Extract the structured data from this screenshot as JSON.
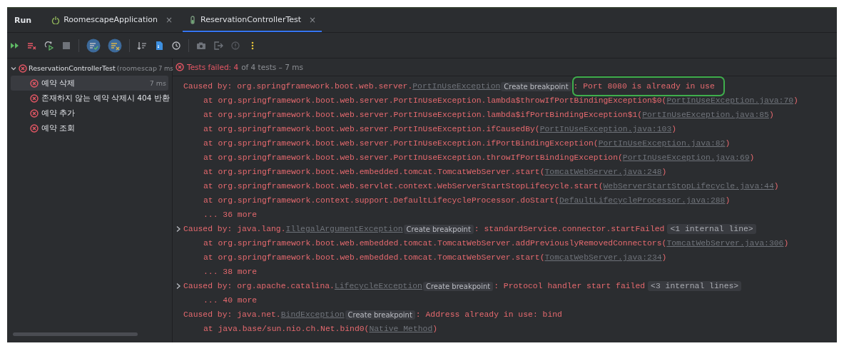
{
  "panel": {
    "title": "Run"
  },
  "tabs": [
    {
      "label": "RoomescapeApplication",
      "close": "×",
      "selected": false
    },
    {
      "label": "ReservationControllerTest",
      "close": "×",
      "selected": true
    }
  ],
  "toolbar": [
    {
      "kind": "rerun"
    },
    {
      "kind": "rerun-failed"
    },
    {
      "kind": "toggle-auto"
    },
    {
      "kind": "stop"
    },
    {
      "kind": "sep"
    },
    {
      "kind": "show-passed",
      "selected": true
    },
    {
      "kind": "show-ignored",
      "selected": true
    },
    {
      "kind": "sep"
    },
    {
      "kind": "sort"
    },
    {
      "kind": "import"
    },
    {
      "kind": "history"
    },
    {
      "kind": "sep"
    },
    {
      "kind": "camera"
    },
    {
      "kind": "export"
    },
    {
      "kind": "info"
    },
    {
      "kind": "more"
    }
  ],
  "tree": {
    "name": "ReservationControllerTest",
    "detail": "(roomescap",
    "time": "7 ms",
    "expanded": true,
    "children": [
      {
        "name": "예약 삭제",
        "time": "7 ms",
        "selected": true
      },
      {
        "name": "존재하지 않는 예약 삭제시 404 반환",
        "selected": false
      },
      {
        "name": "예약 추가",
        "selected": false
      },
      {
        "name": "예약 조회",
        "selected": false
      }
    ]
  },
  "summary": {
    "result": "Tests failed: 4",
    "detail": "of 4 tests – 7 ms"
  },
  "log": [
    {
      "kind": "caused",
      "expandable": false,
      "prefix": "Caused by: org.springframework.boot.web.server.",
      "exception": "PortInUseException",
      "badge": "Create breakpoint",
      "message": ": Port 8080 is already in use",
      "circled": true
    },
    {
      "kind": "at",
      "text": "at org.springframework.boot.web.server.PortInUseException.lambda$throwIfPortBindingException$0(",
      "source": "PortInUseException.java:70",
      "close": ")"
    },
    {
      "kind": "at",
      "text": "at org.springframework.boot.web.server.PortInUseException.lambda$ifPortBindingException$1(",
      "source": "PortInUseException.java:85",
      "close": ")"
    },
    {
      "kind": "at",
      "text": "at org.springframework.boot.web.server.PortInUseException.ifCausedBy(",
      "source": "PortInUseException.java:103",
      "close": ")"
    },
    {
      "kind": "at",
      "text": "at org.springframework.boot.web.server.PortInUseException.ifPortBindingException(",
      "source": "PortInUseException.java:82",
      "close": ")"
    },
    {
      "kind": "at",
      "text": "at org.springframework.boot.web.server.PortInUseException.throwIfPortBindingException(",
      "source": "PortInUseException.java:69",
      "close": ")"
    },
    {
      "kind": "at",
      "text": "at org.springframework.boot.web.embedded.tomcat.TomcatWebServer.start(",
      "source": "TomcatWebServer.java:248",
      "close": ")"
    },
    {
      "kind": "at",
      "text": "at org.springframework.boot.web.servlet.context.WebServerStartStopLifecycle.start(",
      "source": "WebServerStartStopLifecycle.java:44",
      "close": ")"
    },
    {
      "kind": "at",
      "text": "at org.springframework.context.support.DefaultLifecycleProcessor.doStart(",
      "source": "DefaultLifecycleProcessor.java:288",
      "close": ")"
    },
    {
      "kind": "more",
      "text": "... 36 more"
    },
    {
      "kind": "caused",
      "expandable": true,
      "prefix": "Caused by: java.lang.",
      "exception": "IllegalArgumentException",
      "badge": "Create breakpoint",
      "message": ": standardService.connector.startFailed",
      "internal": "<1 internal line>",
      "circled": false
    },
    {
      "kind": "at",
      "text": "at org.springframework.boot.web.embedded.tomcat.TomcatWebServer.addPreviouslyRemovedConnectors(",
      "source": "TomcatWebServer.java:306",
      "close": ")"
    },
    {
      "kind": "at",
      "text": "at org.springframework.boot.web.embedded.tomcat.TomcatWebServer.start(",
      "source": "TomcatWebServer.java:234",
      "close": ")"
    },
    {
      "kind": "more",
      "text": "... 38 more"
    },
    {
      "kind": "caused",
      "expandable": true,
      "prefix": "Caused by: org.apache.catalina.",
      "exception": "LifecycleException",
      "badge": "Create breakpoint",
      "message": ": Protocol handler start failed",
      "internal": "<3 internal lines>",
      "circled": false
    },
    {
      "kind": "more",
      "text": "... 40 more"
    },
    {
      "kind": "caused",
      "expandable": false,
      "prefix": "Caused by: java.net.",
      "exception": "BindException",
      "badge": "Create breakpoint",
      "message": ": Address already in use: bind",
      "circled": false
    },
    {
      "kind": "at",
      "text": "at java.base/sun.nio.ch.Net.bind0(",
      "source": "Native Method",
      "close": ")"
    }
  ]
}
